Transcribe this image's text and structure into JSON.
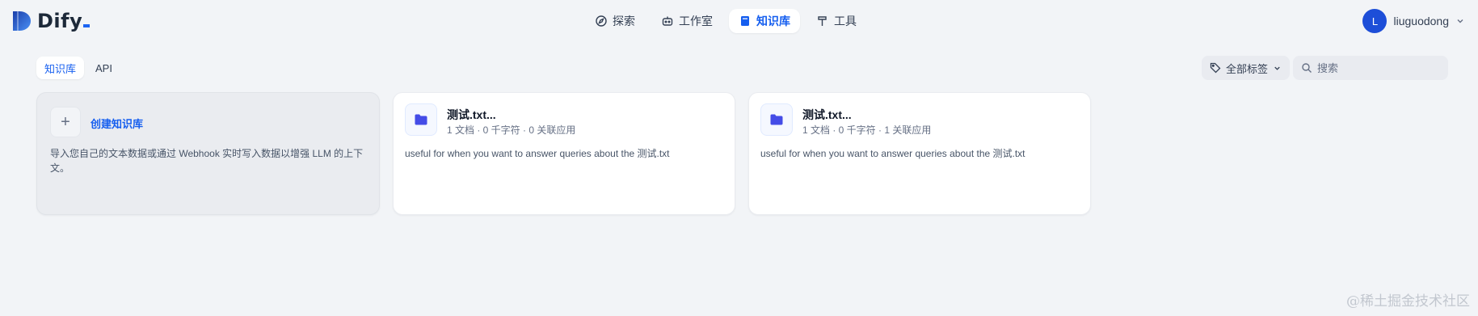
{
  "app": {
    "logo_text": "Dify"
  },
  "nav": {
    "items": [
      {
        "label": "探索",
        "icon": "compass-icon",
        "active": false
      },
      {
        "label": "工作室",
        "icon": "robot-icon",
        "active": false
      },
      {
        "label": "知识库",
        "icon": "book-icon",
        "active": true
      },
      {
        "label": "工具",
        "icon": "hammer-icon",
        "active": false
      }
    ]
  },
  "user": {
    "initial": "L",
    "name": "liuguodong"
  },
  "tabs": [
    {
      "label": "知识库",
      "active": true
    },
    {
      "label": "API",
      "active": false
    }
  ],
  "filter": {
    "tag_label": "全部标签"
  },
  "search": {
    "placeholder": "搜索"
  },
  "create_card": {
    "title": "创建知识库",
    "description": "导入您自己的文本数据或通过 Webhook 实时写入数据以增强 LLM 的上下文。"
  },
  "datasets": [
    {
      "name": "测试.txt...",
      "meta": "1 文档 · 0 千字符 · 0 关联应用",
      "description": "useful for when you want to answer queries about the 测试.txt"
    },
    {
      "name": "测试.txt...",
      "meta": "1 文档 · 0 千字符 · 1 关联应用",
      "description": "useful for when you want to answer queries about the 测试.txt"
    }
  ],
  "watermark": "@稀土掘金技术社区",
  "colors": {
    "accent": "#155eef",
    "background": "#f2f4f7",
    "avatar": "#1d4ed8",
    "folder": "#444ce7"
  }
}
